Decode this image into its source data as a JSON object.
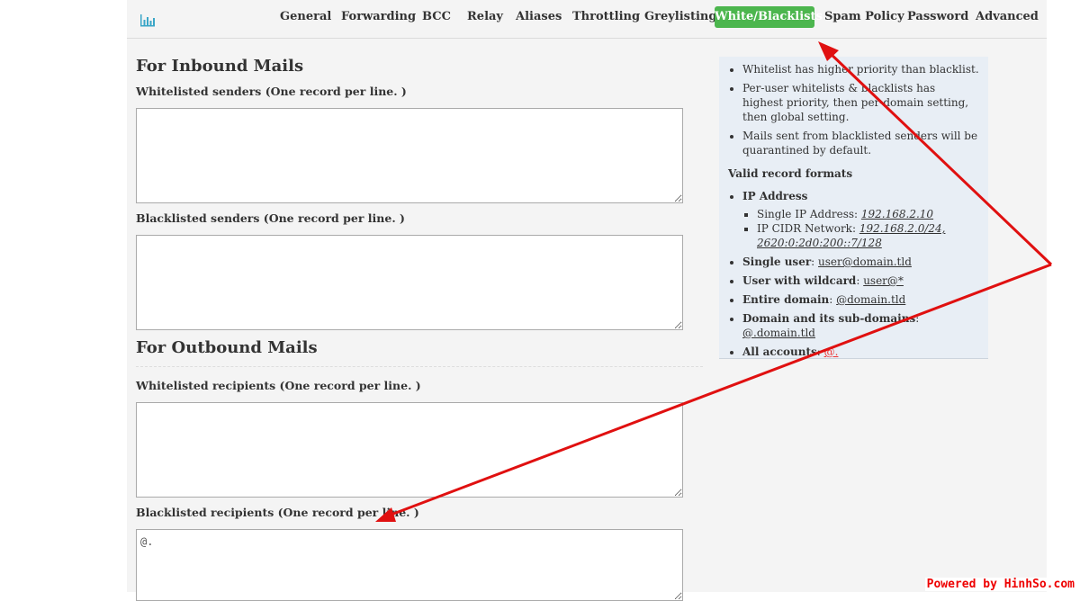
{
  "nav": {
    "items": [
      "General",
      "Forwarding",
      "BCC",
      "Relay",
      "Aliases",
      "Throttling",
      "Greylisting",
      "White/Blacklists",
      "Spam Policy",
      "Password",
      "Advanced"
    ],
    "active": "White/Blacklists"
  },
  "inbound": {
    "title": "For Inbound Mails",
    "whitelisted_label": "Whitelisted senders (One record per line. )",
    "blacklisted_label": "Blacklisted senders (One record per line. )",
    "whitelisted_value": "",
    "blacklisted_value": ""
  },
  "outbound": {
    "title": "For Outbound Mails",
    "whitelisted_label": "Whitelisted recipients (One record per line. )",
    "blacklisted_label": "Blacklisted recipients (One record per line. )",
    "whitelisted_value": "",
    "blacklisted_value": "@."
  },
  "info": {
    "notes": [
      "Whitelist has higher priority than blacklist.",
      "Per-user whitelists & blacklists has highest priority, then per-domain setting, then global setting.",
      "Mails sent from blacklisted senders will be quarantined by default."
    ],
    "formats_title": "Valid record formats",
    "ip_heading": "IP Address",
    "single_ip_label": "Single IP Address: ",
    "single_ip_value": "192.168.2.10",
    "cidr_label": "IP CIDR Network: ",
    "cidr_value": "192.168.2.0/24, 2620:0:2d0:200::7/128",
    "single_user_label": "Single user",
    "single_user_value": "user@domain.tld",
    "wildcard_label": "User with wildcard",
    "wildcard_value": "user@*",
    "entire_domain_label": "Entire domain",
    "entire_domain_value": "@domain.tld",
    "subdomains_label": "Domain and its sub-domains",
    "subdomains_value": "@.domain.tld",
    "all_accounts_label": "All accounts",
    "all_accounts_value": "@."
  },
  "colors": {
    "active_tab": "#4cb64e",
    "annotation_arrow": "#e01010",
    "watermark": "#e00000"
  },
  "icons": {
    "brand": "bar-chart-icon"
  },
  "watermark": "Powered by HinhSo.com"
}
